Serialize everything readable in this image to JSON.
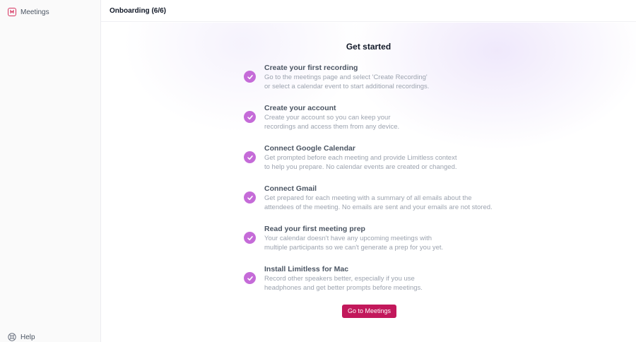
{
  "sidebar": {
    "meetings_label": "Meetings",
    "help_label": "Help"
  },
  "topbar": {
    "title": "Onboarding (6/6)"
  },
  "main": {
    "heading": "Get started",
    "steps": [
      {
        "title": "Create your first recording",
        "desc1": "Go to the meetings page and select 'Create Recording'",
        "desc2": "or select a calendar event to start additional recordings."
      },
      {
        "title": "Create your account",
        "desc1": "Create your account so you can keep your",
        "desc2": "recordings and access them from any device."
      },
      {
        "title": "Connect Google Calendar",
        "desc1": "Get prompted before each meeting and provide Limitless context",
        "desc2": "to help you prepare. No calendar events are created or changed."
      },
      {
        "title": "Connect Gmail",
        "desc1": "Get prepared for each meeting with a summary of all emails about the",
        "desc2": "attendees of the meeting. No emails are sent and your emails are not stored."
      },
      {
        "title": "Read your first meeting prep",
        "desc1": "Your calendar doesn't have any upcoming meetings with",
        "desc2": "multiple participants so we can't generate a prep for you yet."
      },
      {
        "title": "Install Limitless for Mac",
        "desc1": "Record other speakers better, especially if you use",
        "desc2": "headphones and get better prompts before meetings."
      }
    ],
    "cta_label": "Go to Meetings"
  },
  "colors": {
    "accent": "#c2185b",
    "check": "#c56bd8",
    "icon": "#d6335f"
  },
  "icons": [
    "meetings-icon",
    "help-icon",
    "check-icon"
  ]
}
